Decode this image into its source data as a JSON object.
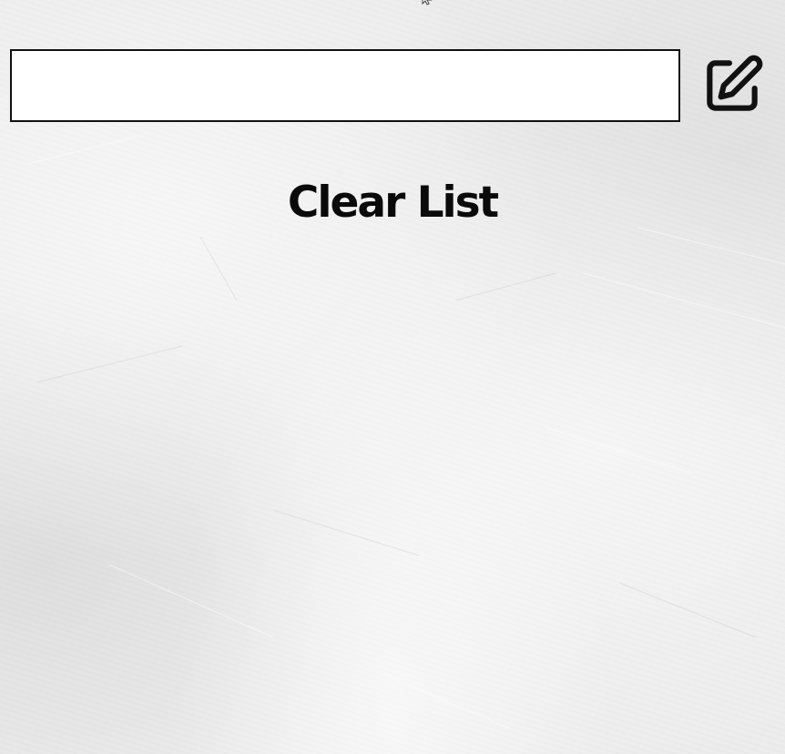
{
  "todo": {
    "input": {
      "value": "",
      "placeholder": ""
    },
    "add_button": {
      "icon": "edit-icon"
    },
    "clear_button": {
      "label": "Clear List"
    },
    "items": []
  },
  "colors": {
    "background": "#ececec",
    "input_border": "#111111",
    "text": "#0a0a0a"
  }
}
